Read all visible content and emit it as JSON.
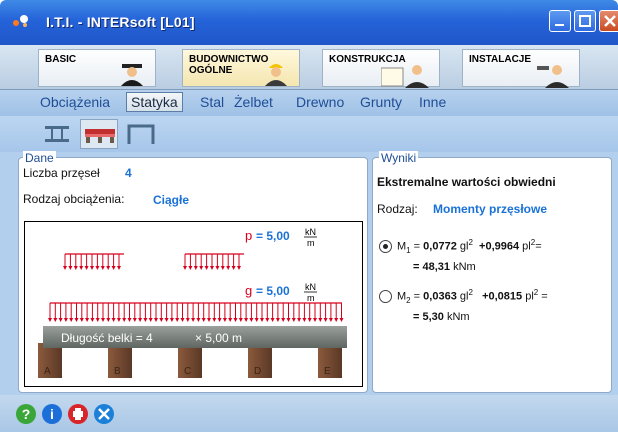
{
  "window": {
    "title": "I.T.I. - INTERsoft [L01]",
    "colors": {
      "titlebar": "#2563d9",
      "accent_blue": "#1a72d6",
      "load_red": "#d6001c"
    }
  },
  "modules": [
    {
      "label": "BASIC"
    },
    {
      "label": "BUDOWNICTWO OGÓLNE"
    },
    {
      "label": "KONSTRUKCJA"
    },
    {
      "label": "INSTALACJE"
    }
  ],
  "submenu": [
    "Obciążenia",
    "Statyka",
    "Stal",
    "Żelbet",
    "Drewno",
    "Grunty",
    "Inne"
  ],
  "submenu_selected": "Statyka",
  "toolbar": {
    "icons": [
      "i-beam-icon",
      "continuous-beam-icon",
      "frame-icon"
    ]
  },
  "dane": {
    "legend": "Dane",
    "spans_label": "Liczba przęseł",
    "spans_value": "4",
    "load_type_label": "Rodzaj obciążenia:",
    "load_type_value": "Ciągłe",
    "diagram": {
      "p_symbol": "p",
      "p_value": "= 5,00",
      "g_symbol": "g",
      "g_value": "= 5,00",
      "unit_num": "kN",
      "unit_den": "m",
      "beam_text": "Długość belki = 4",
      "beam_times": "× 5,00 m",
      "supports": [
        "A",
        "B",
        "C",
        "D",
        "E"
      ]
    }
  },
  "wyniki": {
    "legend": "Wyniki",
    "heading": "Ekstremalne wartości obwiedni",
    "type_label": "Rodzaj:",
    "type_value": "Momenty przęsłowe",
    "m1": {
      "symbol": "M",
      "sub": "1",
      "coef_g": "0,0772",
      "gl": "gl",
      "coef_p": "+0,9964",
      "pl": "pl",
      "result": "= 48,31",
      "unit": "kNm"
    },
    "m2": {
      "symbol": "M",
      "sub": "2",
      "coef_g": "0,0363",
      "gl": "gl",
      "coef_p": "+0,0815",
      "pl": "pl",
      "result": "= 5,30",
      "unit": "kNm"
    },
    "selected": "M1"
  },
  "bottom": {
    "icons": [
      "help-icon",
      "info-icon",
      "print-icon",
      "tools-icon"
    ]
  }
}
